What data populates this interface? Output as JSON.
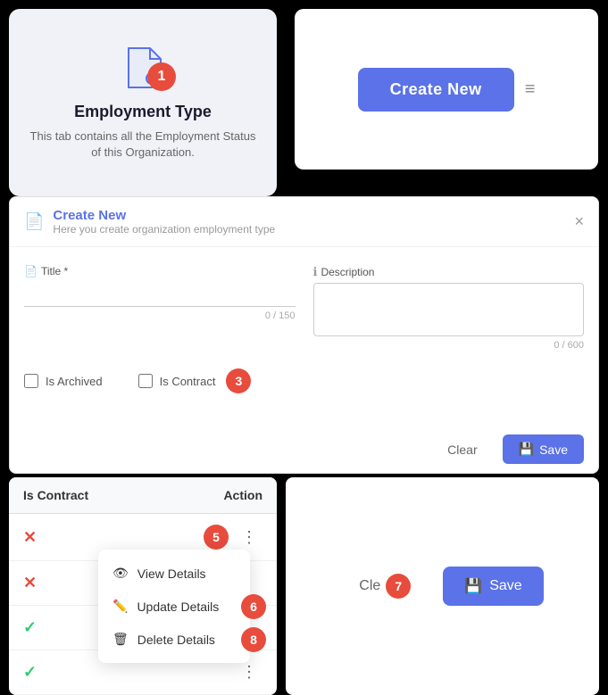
{
  "top": {
    "card": {
      "badge": "1",
      "title": "Employment Type",
      "description": "This tab contains all the Employment Status of this Organization."
    },
    "create_panel": {
      "button_label": "Create New",
      "filter_icon": "≡"
    }
  },
  "modal": {
    "title": "Create New",
    "subtitle": "Here you create organization employment type",
    "close_icon": "×",
    "fields": {
      "title_label": "Title *",
      "title_value": "",
      "title_char_count": "0 / 150",
      "description_label": "Description",
      "description_value": "",
      "description_char_count": "0 / 600"
    },
    "checkboxes": {
      "is_archived": "Is Archived",
      "is_contract": "Is Contract",
      "badge": "3"
    },
    "actions": {
      "clear_label": "Clear",
      "save_label": "Save"
    }
  },
  "table": {
    "header": {
      "col1": "Is Contract",
      "col2": "Action"
    },
    "rows": [
      {
        "status": "x",
        "badge": "5",
        "has_menu": true
      },
      {
        "status": "x",
        "has_menu": false
      },
      {
        "status": "check",
        "has_menu": false
      },
      {
        "status": "check",
        "has_menu": false
      }
    ]
  },
  "context_menu": {
    "items": [
      {
        "icon": "👁",
        "label": "View Details",
        "badge": null
      },
      {
        "icon": "✏️",
        "label": "Update Details",
        "badge": "6"
      },
      {
        "icon": "🗑",
        "label": "Delete Details",
        "badge": "8"
      }
    ]
  },
  "bottom_actions": {
    "clear_label": "Cle",
    "save_label": "Save",
    "badge_7": "7"
  }
}
